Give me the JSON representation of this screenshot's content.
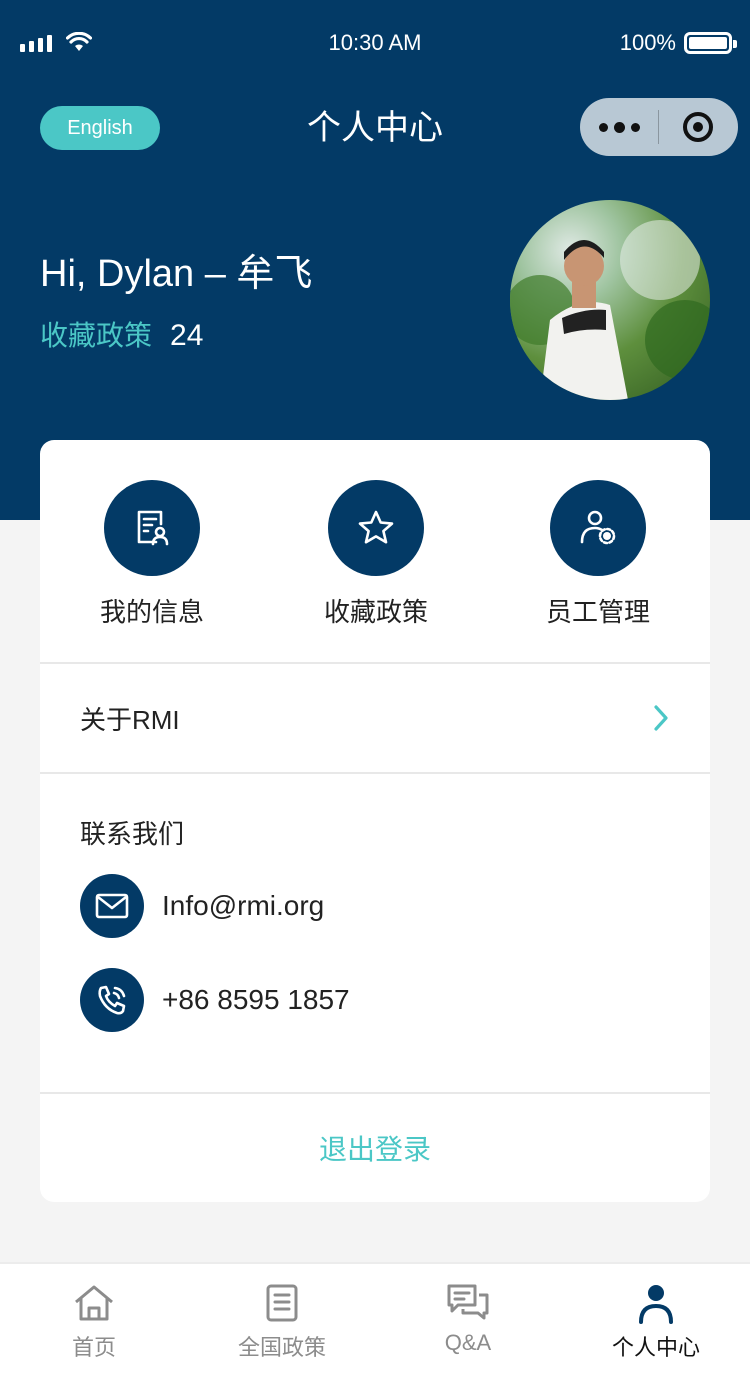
{
  "status_bar": {
    "time": "10:30 AM",
    "battery": "100%"
  },
  "nav": {
    "language_label": "English",
    "title": "个人中心"
  },
  "profile": {
    "greeting": "Hi, Dylan – 牟飞",
    "favorites_label": "收藏政策",
    "favorites_count": "24"
  },
  "quick_actions": [
    {
      "label": "我的信息",
      "icon": "profile-document-icon"
    },
    {
      "label": "收藏政策",
      "icon": "star-icon"
    },
    {
      "label": "员工管理",
      "icon": "user-gear-icon"
    }
  ],
  "about": {
    "label": "关于RMI"
  },
  "contact": {
    "title": "联系我们",
    "email": "Info@rmi.org",
    "phone": "+86 8595 1857"
  },
  "logout_label": "退出登录",
  "tabs": [
    {
      "label": "首页",
      "icon": "home-icon",
      "active": false
    },
    {
      "label": "全国政策",
      "icon": "document-list-icon",
      "active": false
    },
    {
      "label": "Q&A",
      "icon": "chat-icon",
      "active": false
    },
    {
      "label": "个人中心",
      "icon": "person-icon",
      "active": true
    }
  ],
  "colors": {
    "primary": "#033a66",
    "accent": "#4bc7c6",
    "background": "#f4f4f4"
  }
}
